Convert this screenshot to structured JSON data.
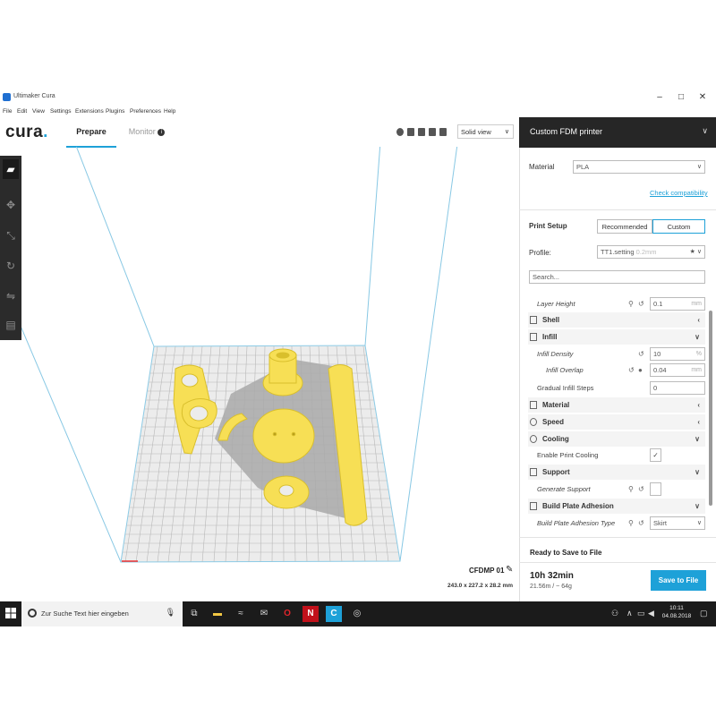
{
  "window": {
    "title": "Ultimaker Cura",
    "controls": {
      "minimize": "–",
      "maximize": "□",
      "close": "✕"
    }
  },
  "menu": [
    "File",
    "Edit",
    "View",
    "Settings",
    "Extensions",
    "Plugins",
    "Preferences",
    "Help"
  ],
  "header": {
    "logo": "cura",
    "logo_dot": ".",
    "tabs": [
      {
        "label": "Prepare",
        "active": true
      },
      {
        "label": "Monitor",
        "active": false
      }
    ],
    "view_mode": "Solid view"
  },
  "viewport": {
    "object_name": "CFDMP 01",
    "object_dims": "243.0 x 227.2 x 28.2 mm",
    "model_color": "#f7df55"
  },
  "panel": {
    "printer": "Custom FDM printer",
    "material_label": "Material",
    "material_value": "PLA",
    "check_compat": "Check compatibility",
    "print_setup": "Print Setup",
    "mode_recommended": "Recommended",
    "mode_custom": "Custom",
    "profile_label": "Profile:",
    "profile_value": "TT1.setting",
    "profile_suffix": "0.2mm",
    "search_placeholder": "Search...",
    "settings": {
      "layer_height": {
        "label": "Layer Height",
        "value": "0.1",
        "unit": "mm"
      },
      "shell": "Shell",
      "infill": "Infill",
      "infill_density": {
        "label": "Infill Density",
        "value": "10",
        "unit": "%"
      },
      "infill_overlap": {
        "label": "Infill Overlap",
        "value": "0.04",
        "unit": "mm"
      },
      "gradual_infill": {
        "label": "Gradual Infill Steps",
        "value": "0"
      },
      "material": "Material",
      "speed": "Speed",
      "cooling": "Cooling",
      "enable_cooling": {
        "label": "Enable Print Cooling",
        "checked": "✓"
      },
      "support": "Support",
      "generate_support": {
        "label": "Generate Support"
      },
      "adhesion": "Build Plate Adhesion",
      "adhesion_type": {
        "label": "Build Plate Adhesion Type",
        "value": "Skirt"
      }
    },
    "ready": "Ready to Save to File",
    "print_time": "10h 32min",
    "material_usage": "21.56m / ~ 64g",
    "save_button": "Save to File"
  },
  "taskbar": {
    "search_text": "Zur Suche Text hier eingeben",
    "time": "10:11",
    "date": "04.08.2018"
  },
  "colors": {
    "accent": "#1ea1d8",
    "dark_bar": "#262626",
    "model": "#f7df55",
    "plate_grid": "#b5b5b5"
  }
}
